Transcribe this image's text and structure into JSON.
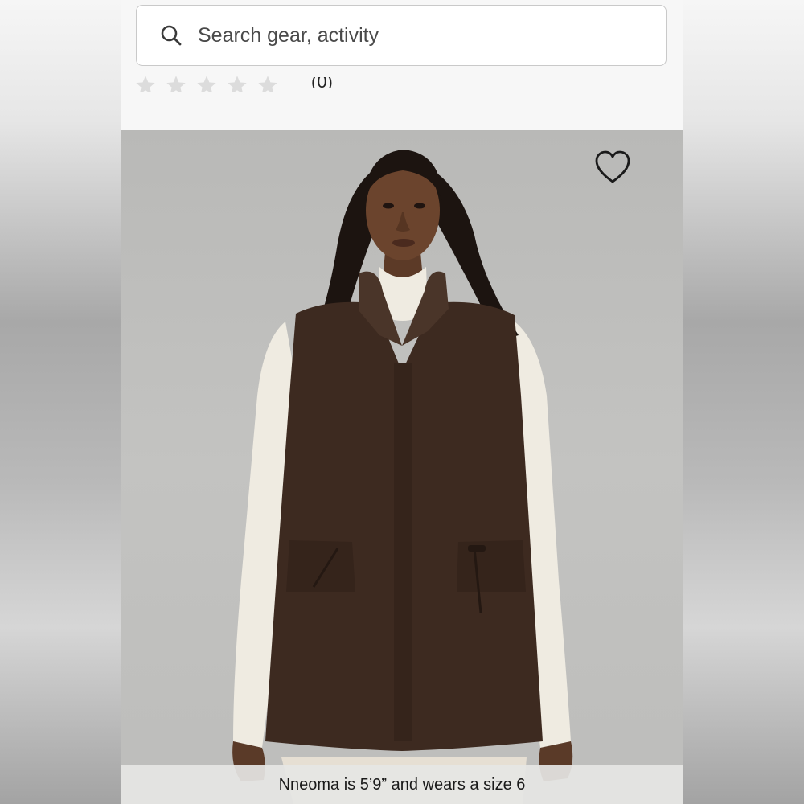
{
  "search": {
    "placeholder": "Search gear, activity"
  },
  "rating": {
    "stars": 5,
    "filled": 0,
    "review_count": "(0)"
  },
  "product": {
    "wishlist_icon": "heart-outline-icon",
    "caption": "Nneoma is 5’9” and wears a size 6"
  },
  "colors": {
    "vest": "#3d2a20",
    "turtleneck": "#eeeae0",
    "image_background": "#bdbdbb",
    "star_empty": "#dcdcdc"
  }
}
